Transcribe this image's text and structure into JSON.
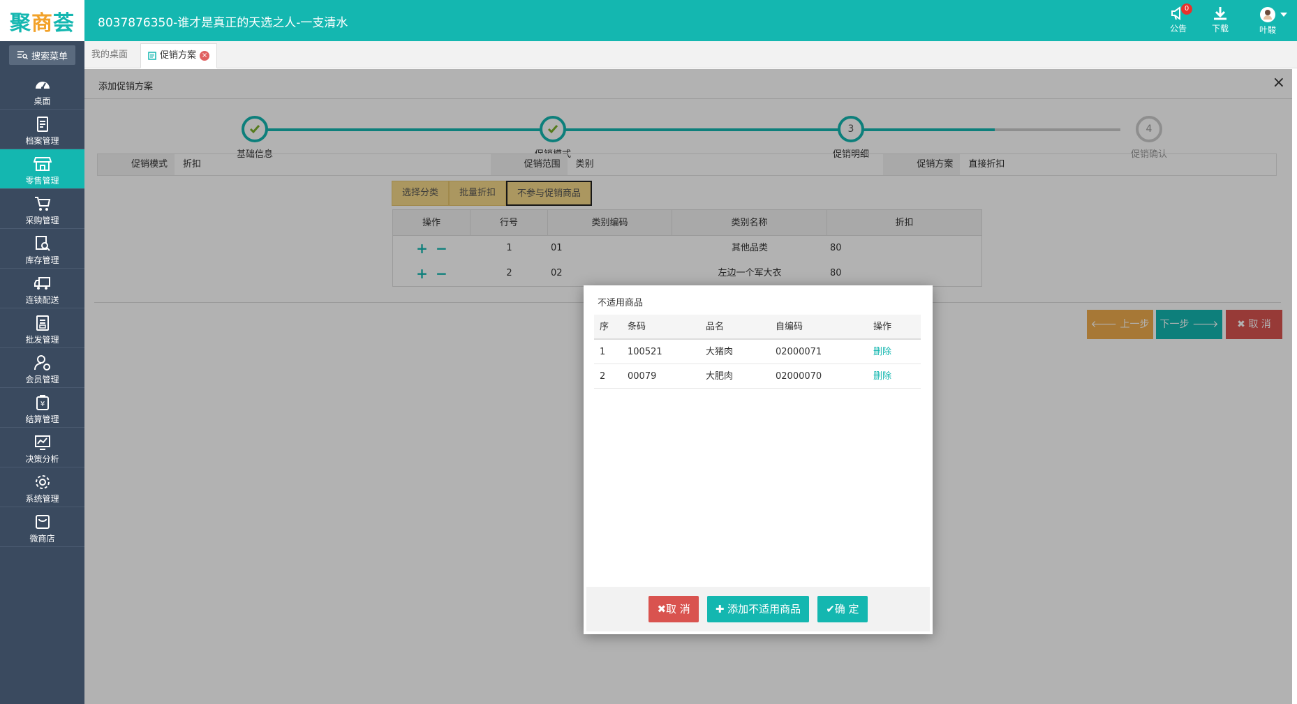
{
  "app": {
    "logo_text_left": "聚",
    "logo_text_mid": "商",
    "logo_text_right": "荟",
    "title": "8037876350-谁才是真正的天选之人-一支清水",
    "notice_label": "公告",
    "notice_count": "0",
    "download_label": "下载",
    "user_name": "叶駿"
  },
  "sidebar": {
    "search_label": "搜索菜单",
    "items": [
      {
        "label": "桌面",
        "icon": "dashboard-icon"
      },
      {
        "label": "档案管理",
        "icon": "archive-icon"
      },
      {
        "label": "零售管理",
        "icon": "store-icon"
      },
      {
        "label": "采购管理",
        "icon": "cart-icon"
      },
      {
        "label": "库存管理",
        "icon": "inventory-search-icon"
      },
      {
        "label": "连锁配送",
        "icon": "truck-icon"
      },
      {
        "label": "批发管理",
        "icon": "wholesale-icon"
      },
      {
        "label": "会员管理",
        "icon": "member-icon"
      },
      {
        "label": "结算管理",
        "icon": "settlement-icon"
      },
      {
        "label": "决策分析",
        "icon": "chart-icon"
      },
      {
        "label": "系统管理",
        "icon": "gear-icon"
      },
      {
        "label": "微商店",
        "icon": "shop-bag-icon"
      }
    ],
    "active_index": 2
  },
  "tabs": [
    {
      "label": "我的桌面"
    },
    {
      "label": "促销方案",
      "close": "×"
    }
  ],
  "panel": {
    "title": "添加促销方案",
    "close": "×"
  },
  "steps": [
    {
      "label": "基础信息",
      "state": "done"
    },
    {
      "label": "促销模式",
      "state": "done"
    },
    {
      "label": "促销明细",
      "state": "current",
      "number": "3"
    },
    {
      "label": "促销确认",
      "state": "todo",
      "number": "4"
    }
  ],
  "info": [
    {
      "key": "促销模式",
      "value": "折扣"
    },
    {
      "key": "促销范围",
      "value": "类别"
    },
    {
      "key": "促销方案",
      "value": "直接折扣"
    }
  ],
  "toolbar": {
    "select_category": "选择分类",
    "batch_discount": "批量折扣",
    "excluded_goods": "不参与促销商品"
  },
  "grid": {
    "headers": [
      "操作",
      "行号",
      "类别编码",
      "类别名称",
      "折扣"
    ],
    "rows": [
      {
        "line": "1",
        "code": "01",
        "name": "其他品类",
        "discount": "80"
      },
      {
        "line": "2",
        "code": "02",
        "name": "左边一个军大衣",
        "discount": "80"
      }
    ],
    "plus": "+",
    "minus": "−"
  },
  "nav": {
    "prev": "上一步",
    "next": "下一步",
    "cancel": "取 消"
  },
  "modal": {
    "title": "不适用商品",
    "headers": [
      "序",
      "条码",
      "品名",
      "自编码",
      "操作"
    ],
    "rows": [
      {
        "seq": "1",
        "barcode": "100521",
        "name": "大猪肉",
        "code": "02000071",
        "action": "删除"
      },
      {
        "seq": "2",
        "barcode": "00079",
        "name": "大肥肉",
        "code": "02000070",
        "action": "删除"
      }
    ],
    "cancel": "取 消",
    "add": "添加不适用商品",
    "confirm": "确 定"
  },
  "colors": {
    "brand": "#14b7b0",
    "sidebar": "#3a4a5f",
    "danger": "#d9534f",
    "warning": "#f0ad4e",
    "toolbar_yellow": "#f5d88a"
  }
}
